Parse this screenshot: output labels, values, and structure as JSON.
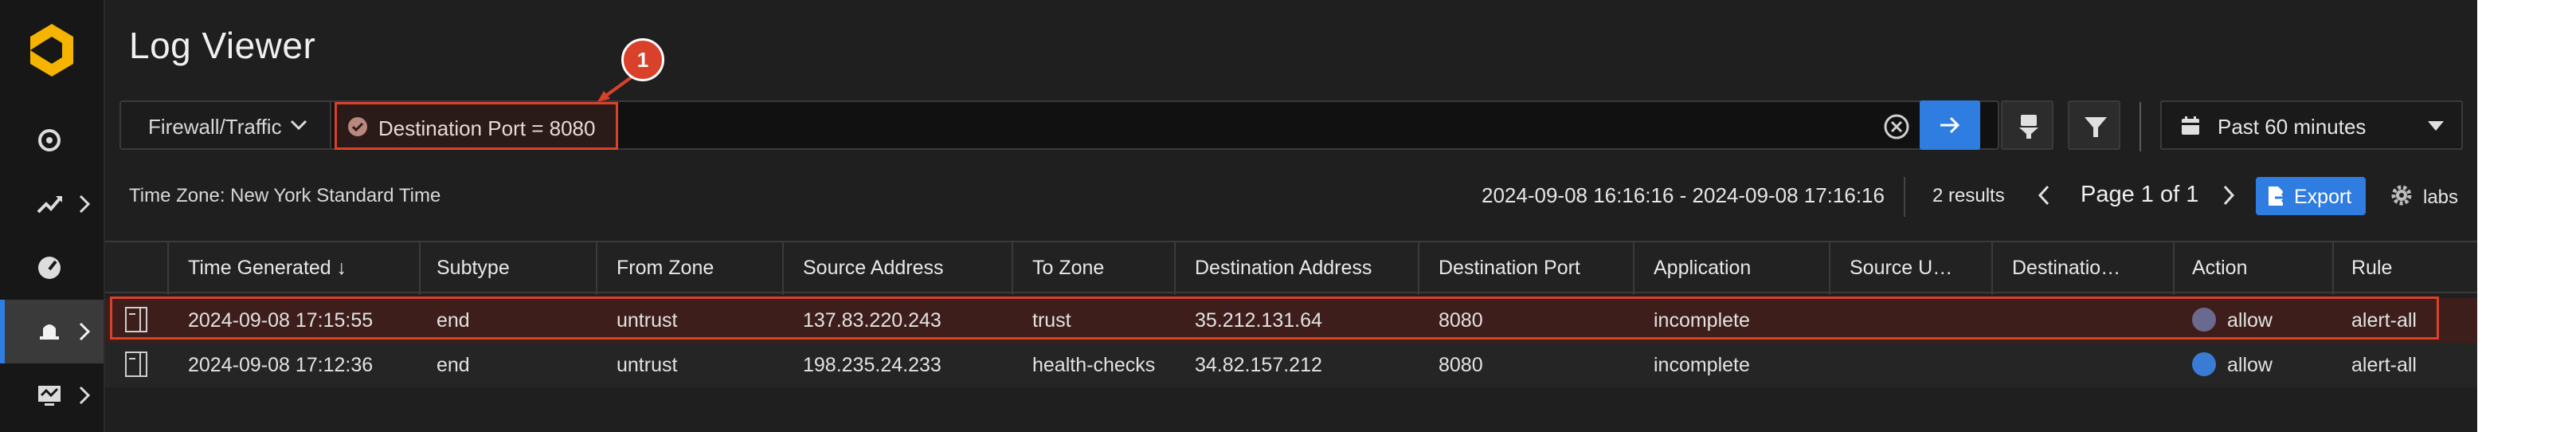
{
  "app": {
    "title": "Log Viewer"
  },
  "sidebar": {
    "items": [
      {
        "icon": "target-icon"
      },
      {
        "icon": "analytics-icon"
      },
      {
        "icon": "dashboard-gauge-icon"
      },
      {
        "icon": "alert-bell-icon",
        "active": true
      },
      {
        "icon": "monitor-icon"
      }
    ]
  },
  "query": {
    "log_type": "Firewall/Traffic",
    "filter": "Destination Port = 8080"
  },
  "timerange": {
    "label": "Past 60 minutes"
  },
  "annotation": {
    "number": "1"
  },
  "info": {
    "timezone": "Time Zone: New York Standard Time",
    "range": "2024-09-08 16:16:16 - 2024-09-08 17:16:16",
    "results": "2 results",
    "page": "Page 1 of 1",
    "export": "Export",
    "labs": "labs"
  },
  "table": {
    "headers": [
      "Time Generated ↓",
      "Subtype",
      "From Zone",
      "Source Address",
      "To Zone",
      "Destination Address",
      "Destination Port",
      "Application",
      "Source U…",
      "Destinatio…",
      "Action",
      "Rule"
    ],
    "rows": [
      [
        "2024-09-08 17:15:55",
        "end",
        "untrust",
        "137.83.220.243",
        "trust",
        "35.212.131.64",
        "8080",
        "incomplete",
        "",
        "",
        "allow",
        "alert-all"
      ],
      [
        "2024-09-08 17:12:36",
        "end",
        "untrust",
        "198.235.24.233",
        "health-checks",
        "34.82.157.212",
        "8080",
        "incomplete",
        "",
        "",
        "allow",
        "alert-all"
      ]
    ],
    "action_dot_colors": [
      "#6a6a8e",
      "#3a7bd5"
    ]
  },
  "colors": {
    "accent": "#2f7de1",
    "highlight": "#d9412b",
    "background": "#1f1f1f"
  }
}
